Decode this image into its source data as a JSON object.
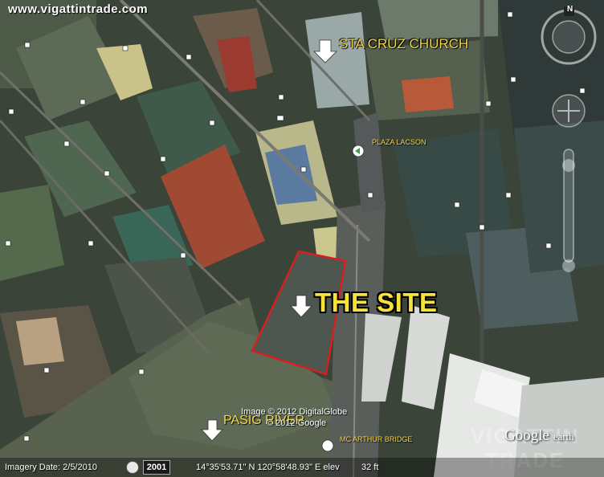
{
  "watermark_top": "www.vigattintrade.com",
  "labels": {
    "church": "STA CRUZ CHURCH",
    "plaza": "PLAZA LACSON",
    "site": "THE SITE",
    "river": "PASIG RIVER",
    "bridge": "MC ARTHUR BRIDGE"
  },
  "credits": {
    "line1": "Image © 2012 DigitalGlobe",
    "line2": "© 2012 Google"
  },
  "branding": {
    "google_earth_main": "Google",
    "google_earth_sub": "earth",
    "watermark_bottom_1": "VIGATTIN",
    "watermark_bottom_2": "TRADE"
  },
  "status": {
    "imagery_date": "Imagery Date: 2/5/2010",
    "year": "2001",
    "coords": "14°35'53.71\" N 120°58'48.93\" E elev",
    "elev": "32 ft"
  },
  "nav": {
    "north": "N"
  },
  "colors": {
    "site_outline": "#d42020",
    "label_yellow": "#f2d64a",
    "site_text": "#f8e23a"
  }
}
